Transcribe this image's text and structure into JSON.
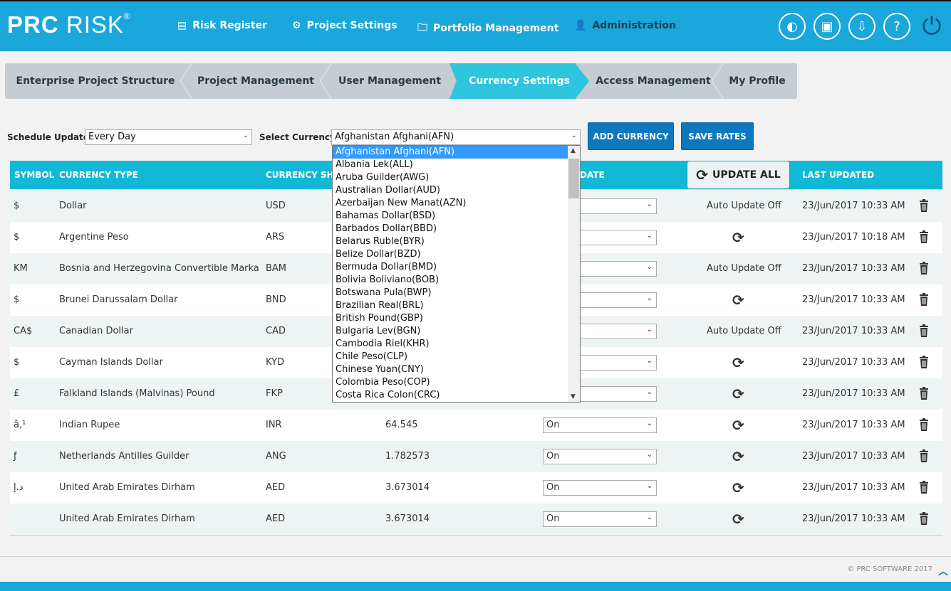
{
  "app": {
    "logo": "PRC RISK",
    "registered": "®"
  },
  "nav": [
    {
      "label": "Risk Register",
      "icon": "list-icon"
    },
    {
      "label": "Project Settings",
      "icon": "settings-icon"
    },
    {
      "label": "Portfolio Management",
      "icon": "folder-icon"
    },
    {
      "label": "Administration",
      "icon": "user-icon"
    }
  ],
  "header_icons": [
    "toggle-icon",
    "calendar-download-icon",
    "inbox-download-icon",
    "help-icon",
    "power-icon"
  ],
  "tabs": [
    {
      "label": "Enterprise Project Structure"
    },
    {
      "label": "Project Management"
    },
    {
      "label": "User Management"
    },
    {
      "label": "Currency Settings",
      "active": true
    },
    {
      "label": "Access Management"
    },
    {
      "label": "My Profile"
    }
  ],
  "controls": {
    "schedule_label": "Schedule Update :",
    "schedule_value": "Every Day",
    "currency_label": "Select Currency :",
    "currency_value": "Afghanistan Afghani(AFN)",
    "add_currency": "ADD CURRENCY",
    "save_rates": "SAVE RATES"
  },
  "dropdown_options": [
    "Afghanistan Afghani(AFN)",
    "Albania Lek(ALL)",
    "Aruba Guilder(AWG)",
    "Australian Dollar(AUD)",
    "Azerbaijan New Manat(AZN)",
    "Bahamas Dollar(BSD)",
    "Barbados Dollar(BBD)",
    "Belarus Ruble(BYR)",
    "Belize Dollar(BZD)",
    "Bermuda Dollar(BMD)",
    "Bolivia Boliviano(BOB)",
    "Botswana Pula(BWP)",
    "Brazilian Real(BRL)",
    "British Pound(GBP)",
    "Bulgaria Lev(BGN)",
    "Cambodia Riel(KHR)",
    "Chile Peso(CLP)",
    "Chinese Yuan(CNY)",
    "Colombia Peso(COP)",
    "Costa Rica Colon(CRC)"
  ],
  "table": {
    "headers": {
      "symbol": "SYMBOL",
      "type": "CURRENCY TYPE",
      "short": "CURRENCY SHO",
      "auto": "DATE",
      "update_all": "UPDATE ALL",
      "last": "LAST UPDATED"
    },
    "rows": [
      {
        "symbol": "$",
        "type": "Dollar",
        "short": "USD",
        "rate": "",
        "auto": "",
        "status": "Auto Update Off",
        "last": "23/Jun/2017 10:33 AM"
      },
      {
        "symbol": "$",
        "type": "Argentine Peso",
        "short": "ARS",
        "rate": "",
        "auto": "",
        "status": "refresh",
        "last": "23/Jun/2017 10:18 AM"
      },
      {
        "symbol": "KM",
        "type": "Bosnia and Herzegovina Convertible Marka",
        "short": "BAM",
        "rate": "",
        "auto": "",
        "status": "Auto Update Off",
        "last": "23/Jun/2017 10:33 AM"
      },
      {
        "symbol": "$",
        "type": "Brunei Darussalam Dollar",
        "short": "BND",
        "rate": "",
        "auto": "",
        "status": "refresh",
        "last": "23/Jun/2017 10:33 AM"
      },
      {
        "symbol": "CA$",
        "type": "Canadian Dollar",
        "short": "CAD",
        "rate": "",
        "auto": "",
        "status": "Auto Update Off",
        "last": "23/Jun/2017 10:33 AM"
      },
      {
        "symbol": "$",
        "type": "Cayman Islands Dollar",
        "short": "KYD",
        "rate": "",
        "auto": "",
        "status": "refresh",
        "last": "23/Jun/2017 10:33 AM"
      },
      {
        "symbol": "£",
        "type": "Falkland Islands (Malvinas) Pound",
        "short": "FKP",
        "rate": "",
        "auto": "",
        "status": "refresh",
        "last": "23/Jun/2017 10:33 AM"
      },
      {
        "symbol": "â‚¹",
        "type": "Indian Rupee",
        "short": "INR",
        "rate": "64.545",
        "auto": "On",
        "status": "refresh",
        "last": "23/Jun/2017 10:33 AM"
      },
      {
        "symbol": "ƒ",
        "type": "Netherlands Antilles Guilder",
        "short": "ANG",
        "rate": "1.782573",
        "auto": "On",
        "status": "refresh",
        "last": "23/Jun/2017 10:33 AM"
      },
      {
        "symbol": "د.إ",
        "type": "United Arab Emirates Dirham",
        "short": "AED",
        "rate": "3.673014",
        "auto": "On",
        "status": "refresh",
        "last": "23/Jun/2017 10:33 AM"
      },
      {
        "symbol": "",
        "type": "United Arab Emirates Dirham",
        "short": "AED",
        "rate": "3.673014",
        "auto": "On",
        "status": "refresh",
        "last": "23/Jun/2017 10:33 AM"
      }
    ]
  },
  "footer": {
    "copyright": "© PRC SOFTWARE 2017"
  },
  "colors": {
    "header": "#1aa7db",
    "active_tab": "#2ec5de",
    "table_header": "#12b9d6",
    "button": "#0c78c0"
  }
}
